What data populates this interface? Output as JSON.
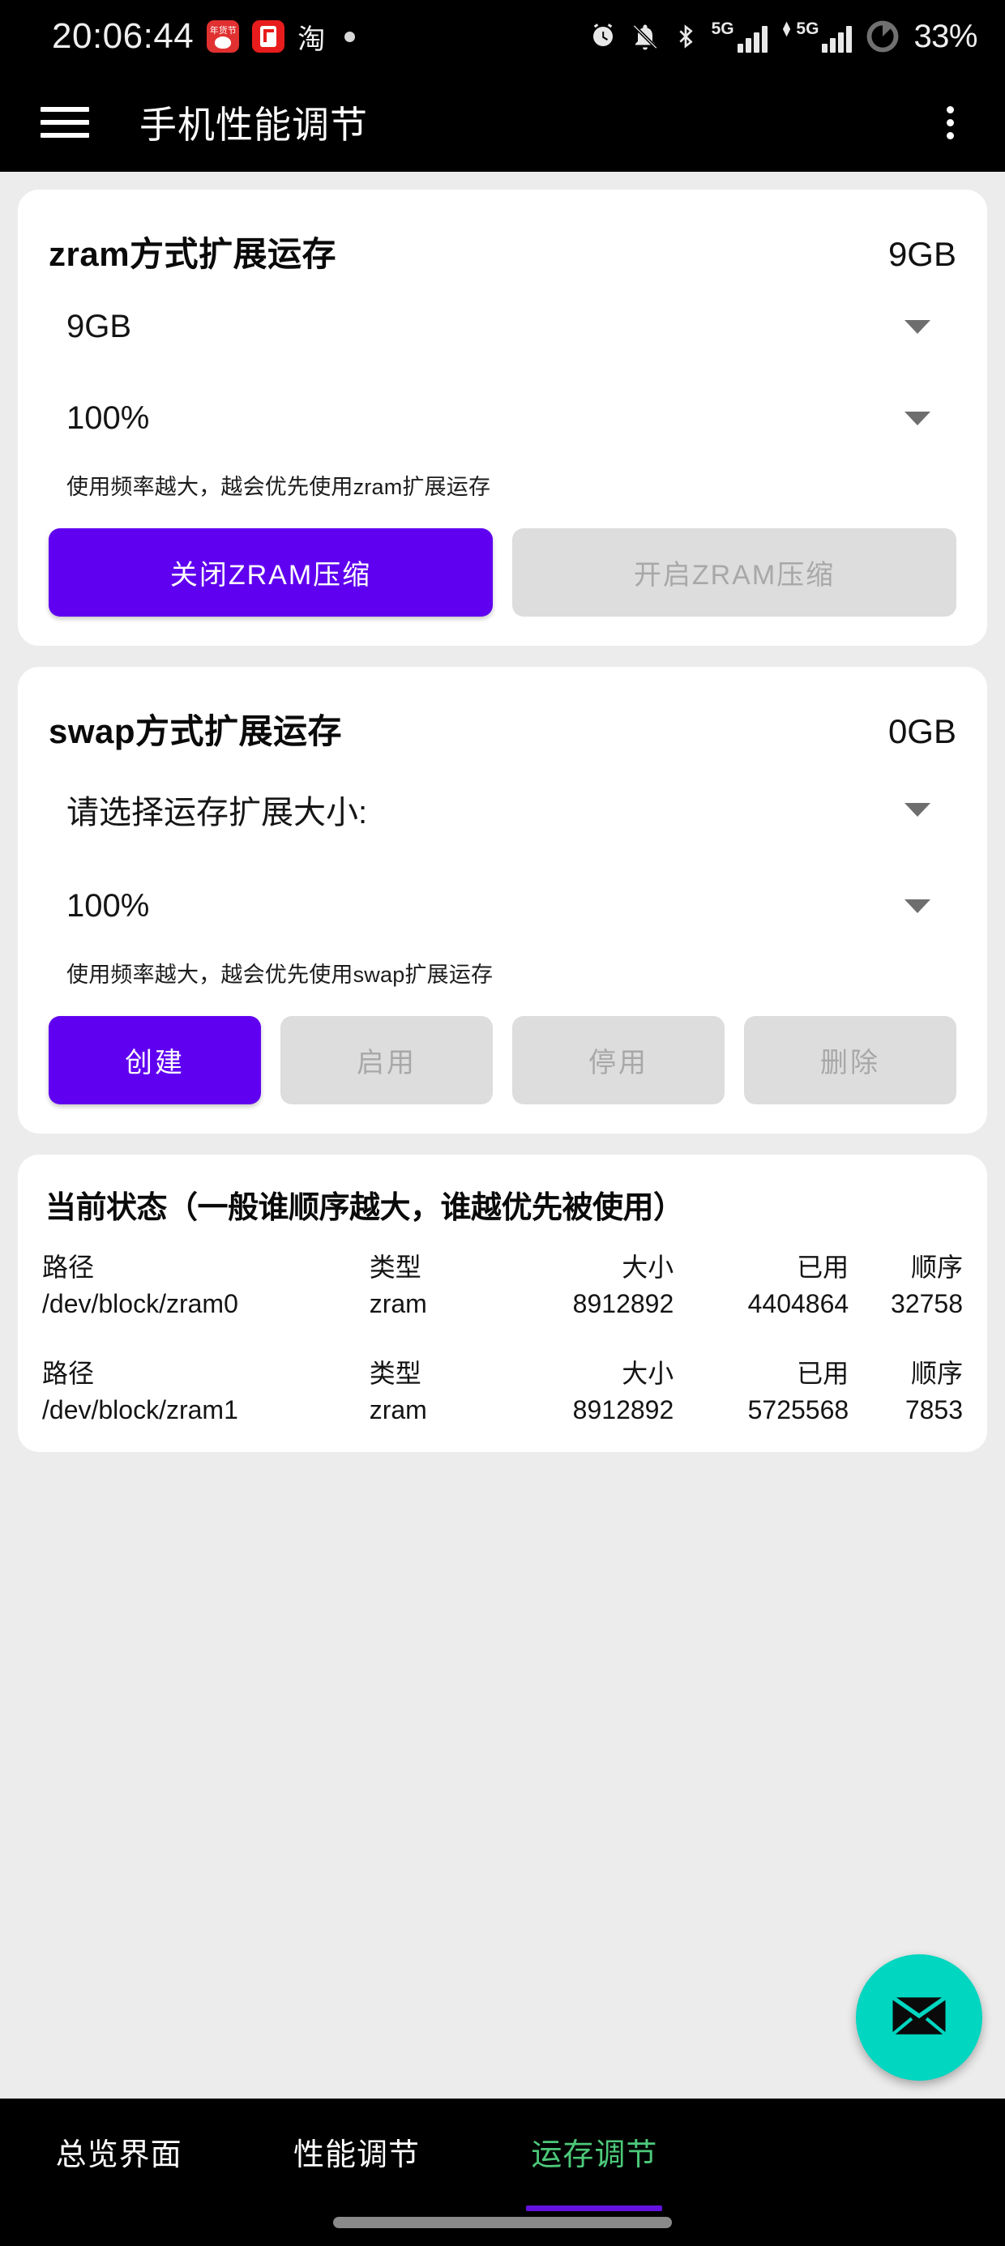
{
  "status_bar": {
    "clock": "20:06:44",
    "tray_icons": [
      "jd-app-icon",
      "red-note-app-icon",
      "taobao-app-icon",
      "dot-indicator"
    ],
    "taobao_glyph": "淘",
    "right_icons": [
      "alarm-icon",
      "bell-muted-icon",
      "bluetooth-icon",
      "signal-5g-icon",
      "signal-5g-data-icon",
      "battery-icon"
    ],
    "network_label_1": "5G",
    "network_label_2": "5G",
    "battery_percent": "33%"
  },
  "app_bar": {
    "title": "手机性能调节",
    "menu_icon": "hamburger-icon",
    "overflow_icon": "more-vertical-icon"
  },
  "zram_card": {
    "title": "zram方式扩展运存",
    "value": "9GB",
    "size_spinner": "9GB",
    "percent_spinner": "100%",
    "hint": "使用频率越大，越会优先使用zram扩展运存",
    "buttons": [
      {
        "label": "关闭ZRAM压缩",
        "state": "enabled"
      },
      {
        "label": "开启ZRAM压缩",
        "state": "disabled"
      }
    ]
  },
  "swap_card": {
    "title": "swap方式扩展运存",
    "value": "0GB",
    "size_spinner": "请选择运存扩展大小:",
    "percent_spinner": "100%",
    "hint": "使用频率越大，越会优先使用swap扩展运存",
    "buttons": [
      {
        "label": "创建",
        "state": "enabled"
      },
      {
        "label": "启用",
        "state": "disabled"
      },
      {
        "label": "停用",
        "state": "disabled"
      },
      {
        "label": "删除",
        "state": "disabled"
      }
    ]
  },
  "status_card": {
    "title": "当前状态（一般谁顺序越大，谁越优先被使用）",
    "columns": [
      "路径",
      "类型",
      "大小",
      "已用",
      "顺序"
    ],
    "rows": [
      {
        "path": "/dev/block/zram0",
        "type": "zram",
        "size": "8912892",
        "used": "4404864",
        "order": "32758"
      },
      {
        "path": "/dev/block/zram1",
        "type": "zram",
        "size": "8912892",
        "used": "5725568",
        "order": "7853"
      }
    ]
  },
  "fab": {
    "icon": "envelope-icon",
    "color": "#00D6C0"
  },
  "bottom_nav": {
    "tabs": [
      {
        "label": "总览界面",
        "active": false
      },
      {
        "label": "性能调节",
        "active": false
      },
      {
        "label": "运存调节",
        "active": true
      }
    ],
    "active_color": "#4CC97A",
    "indicator_color": "#6412E0"
  },
  "theme": {
    "primary": "#6000F0",
    "page_bg": "#ECECEC",
    "card_bg": "#FFFFFF",
    "bar_bg": "#000000"
  }
}
